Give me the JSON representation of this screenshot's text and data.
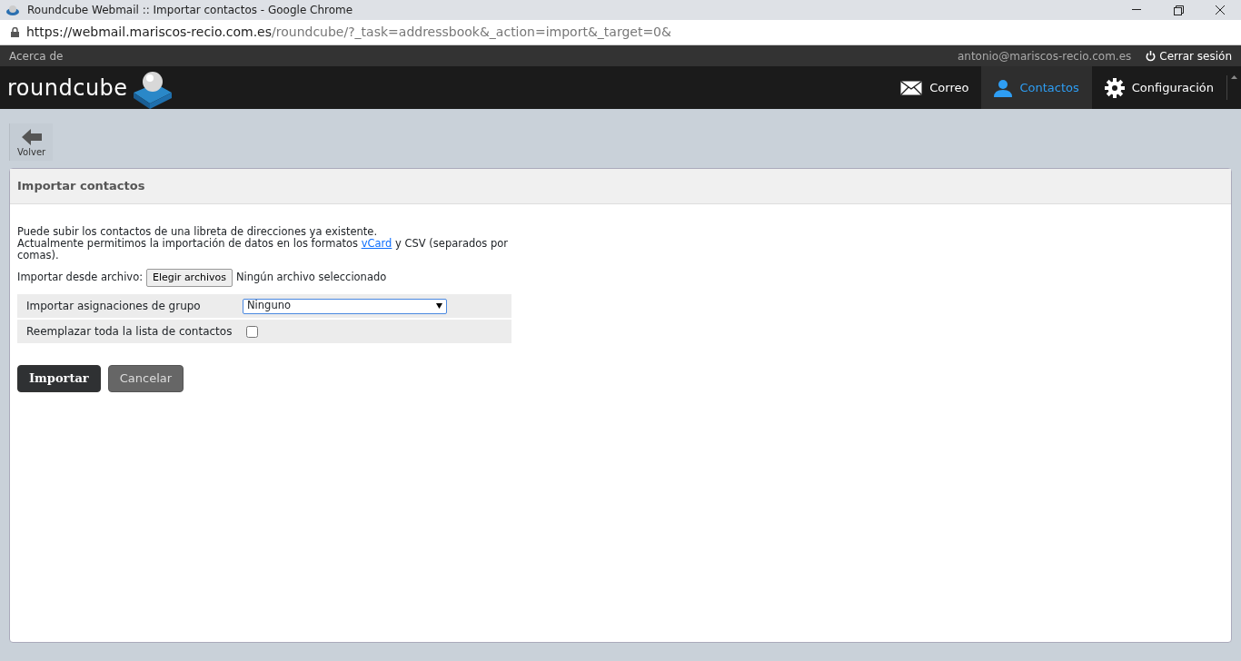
{
  "browser": {
    "title": "Roundcube Webmail :: Importar contactos - Google Chrome",
    "url_host": "https://webmail.mariscos-recio.com.es",
    "url_path": "/roundcube/?_task=addressbook&_action=import&_target=0&"
  },
  "topbar": {
    "about": "Acerca de",
    "user": "antonio@mariscos-recio.com.es",
    "logout": "Cerrar sesión"
  },
  "logo": "roundcube",
  "nav": [
    {
      "kind": "mail",
      "label": "Correo",
      "selected": false
    },
    {
      "kind": "contacts",
      "label": "Contactos",
      "selected": true
    },
    {
      "kind": "settings",
      "label": "Configuración",
      "selected": false
    }
  ],
  "toolbar": {
    "back": "Volver"
  },
  "panel": {
    "title": "Importar contactos",
    "intro": "Puede subir los contactos de una libreta de direcciones ya existente.",
    "formats": {
      "before": "Actualmente permitimos la importación de datos en los formatos ",
      "link": "vCard",
      "after": " y CSV (separados por comas)."
    },
    "file": {
      "label": "Importar desde archivo:",
      "button": "Elegir archivos",
      "status": "Ningún archivo seleccionado"
    },
    "options": [
      {
        "kind": "select",
        "label": "Importar asignaciones de grupo",
        "value": "Ninguno"
      },
      {
        "kind": "checkbox",
        "label": "Reemplazar toda la lista de contactos",
        "checked": false
      }
    ],
    "buttons": [
      {
        "kind": "primary",
        "label": "Importar"
      },
      {
        "kind": "secondary",
        "label": "Cancelar"
      }
    ]
  }
}
